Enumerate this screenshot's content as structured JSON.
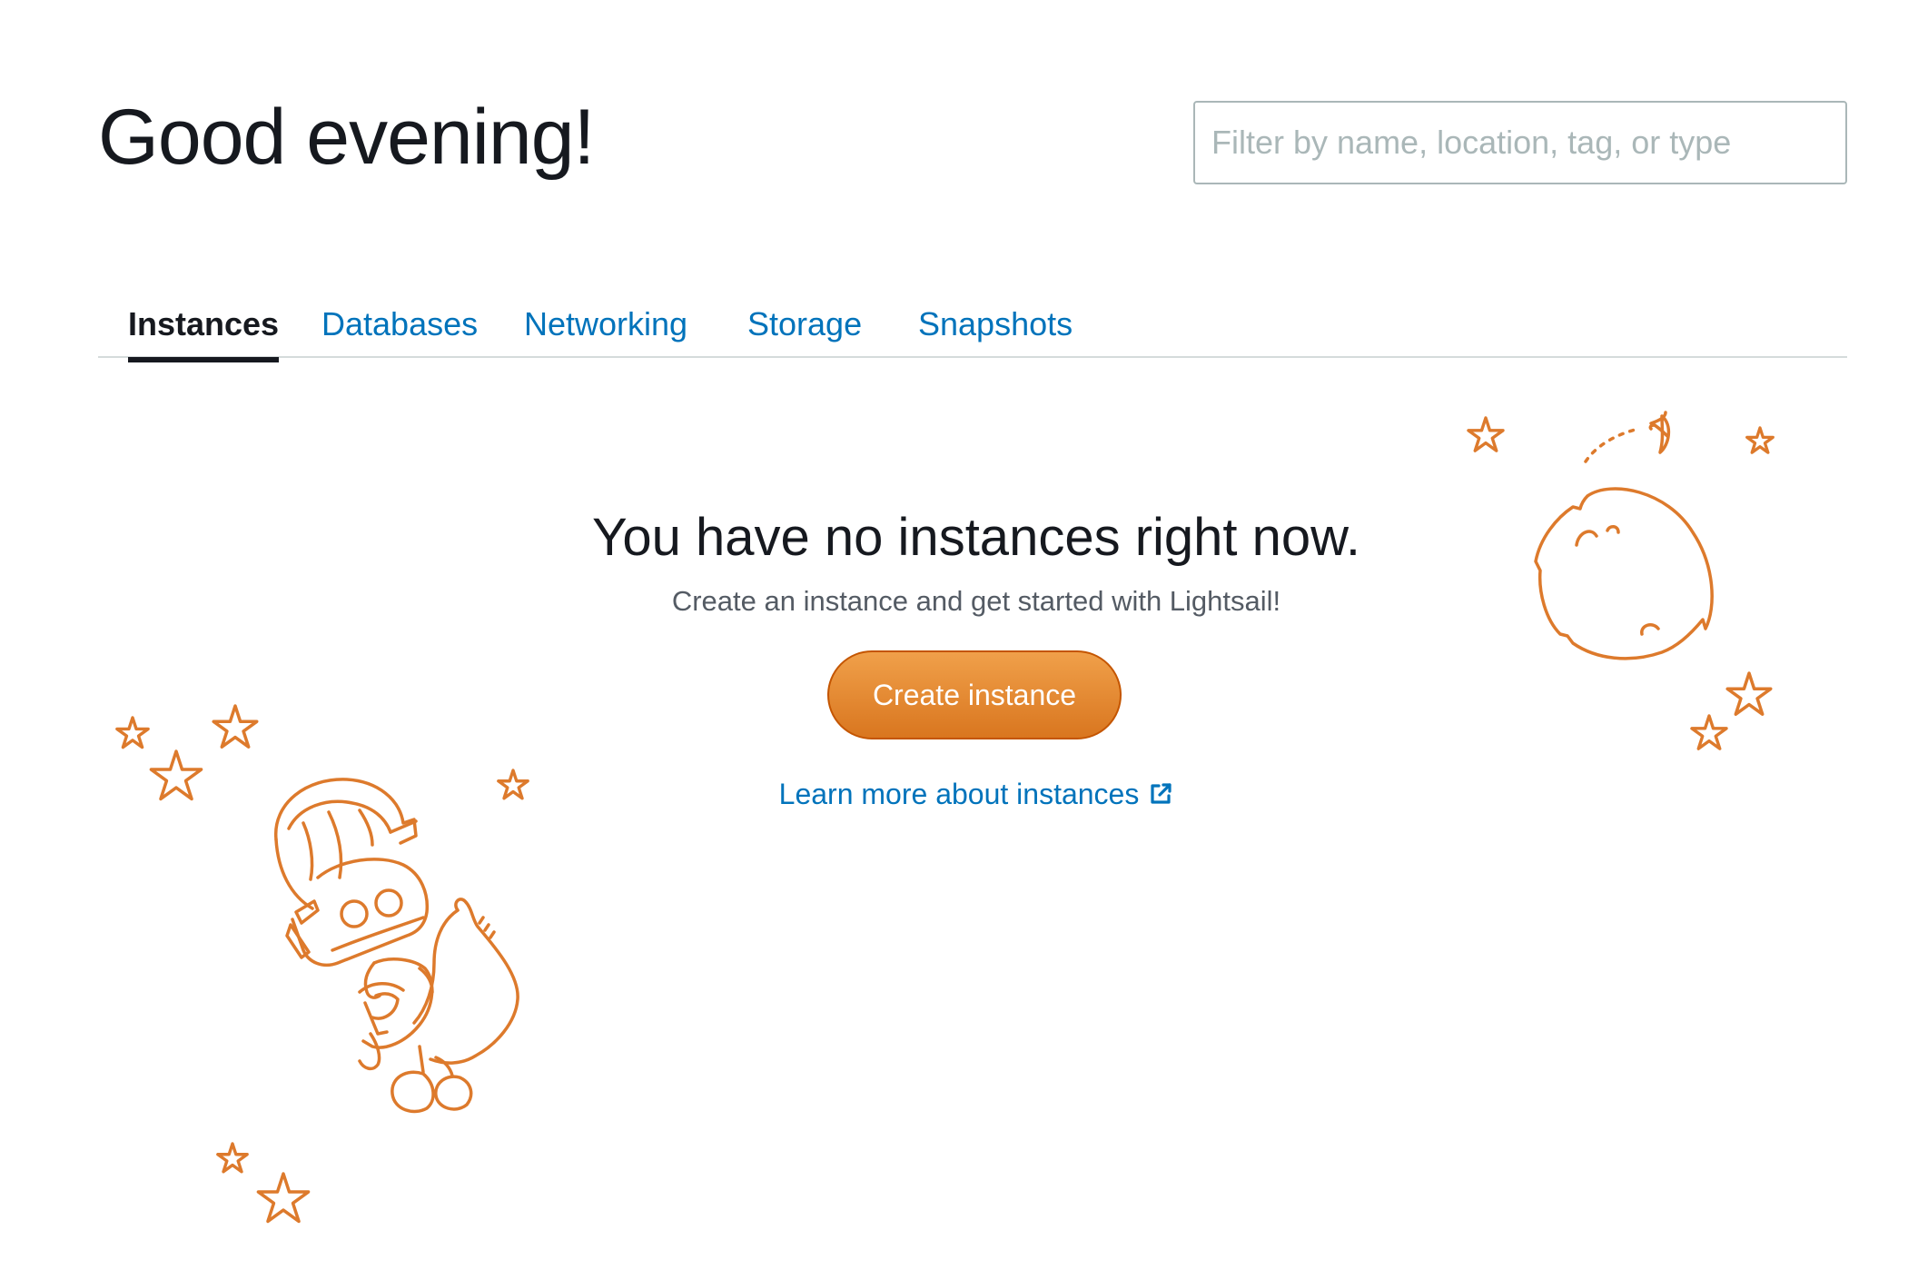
{
  "header": {
    "greeting": "Good evening!",
    "filter_placeholder": "Filter by name, location, tag, or type"
  },
  "tabs": [
    {
      "label": "Instances",
      "active": true
    },
    {
      "label": "Databases",
      "active": false
    },
    {
      "label": "Networking",
      "active": false
    },
    {
      "label": "Storage",
      "active": false
    },
    {
      "label": "Snapshots",
      "active": false
    }
  ],
  "empty_state": {
    "title": "You have no instances right now.",
    "subtitle": "Create an instance and get started with Lightsail!",
    "create_button_label": "Create instance",
    "learn_more_label": "Learn more about instances"
  },
  "icons": {
    "learn_more": "external-link-icon",
    "illustration_left": "robot-astronaut-illustration",
    "illustration_right": "moon-illustration",
    "decoration": "star-icon"
  },
  "colors": {
    "accent": "#ec7211",
    "link": "#0073bb",
    "illustration": "#dd7a2c",
    "text": "#16191f",
    "muted": "#545b64"
  }
}
